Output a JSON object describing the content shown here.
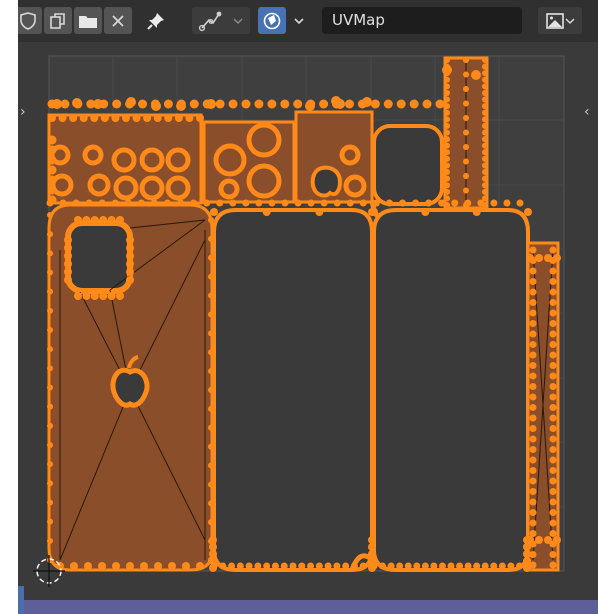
{
  "header": {
    "uv_map_name": "UVMap",
    "icons": {
      "shield": "fake-user-shield-icon",
      "duplicate": "duplicate-image-icon",
      "open": "open-folder-icon",
      "close": "unlink-x-icon",
      "pin": "pin-icon",
      "sticky_selection": "sticky-selection-icon",
      "uv_sync": "uv-sync-selection-icon",
      "image_browse": "image-browse-icon"
    }
  },
  "colors": {
    "editor_bg": "#303030",
    "grid_bg": "#3a3a3a",
    "uv_face_fill": "#8a4f2a",
    "uv_vertex": "#ff8a19",
    "uv_edge": "#1a0f05",
    "active_button": "#4772b3",
    "status_strip": "#5e5e99"
  }
}
